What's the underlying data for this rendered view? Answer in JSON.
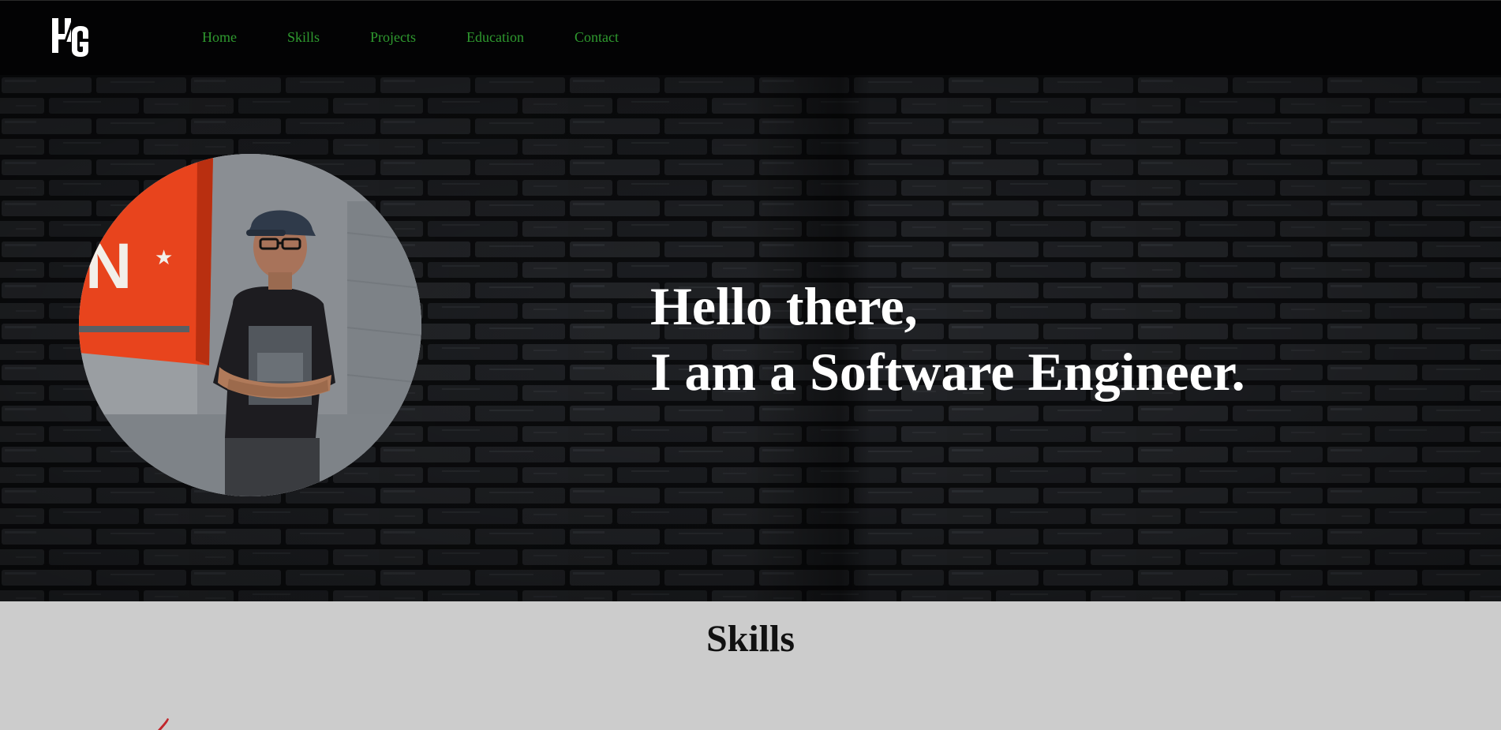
{
  "brand": {
    "logo_alt": "HG logo",
    "logo_icon": "hg-monogram-icon"
  },
  "nav": {
    "items": [
      {
        "label": "Home"
      },
      {
        "label": "Skills"
      },
      {
        "label": "Projects"
      },
      {
        "label": "Education"
      },
      {
        "label": "Contact"
      }
    ]
  },
  "hero": {
    "greeting_line1": "Hello there,",
    "greeting_line2": "I am a Software Engineer.",
    "photo_alt": "Profile photo"
  },
  "skills": {
    "title": "Skills"
  },
  "colors": {
    "nav_bg": "#030304",
    "nav_link": "#2f9a2f",
    "hero_text": "#ffffff",
    "skills_bg": "#cccccc",
    "skills_title": "#111111"
  }
}
